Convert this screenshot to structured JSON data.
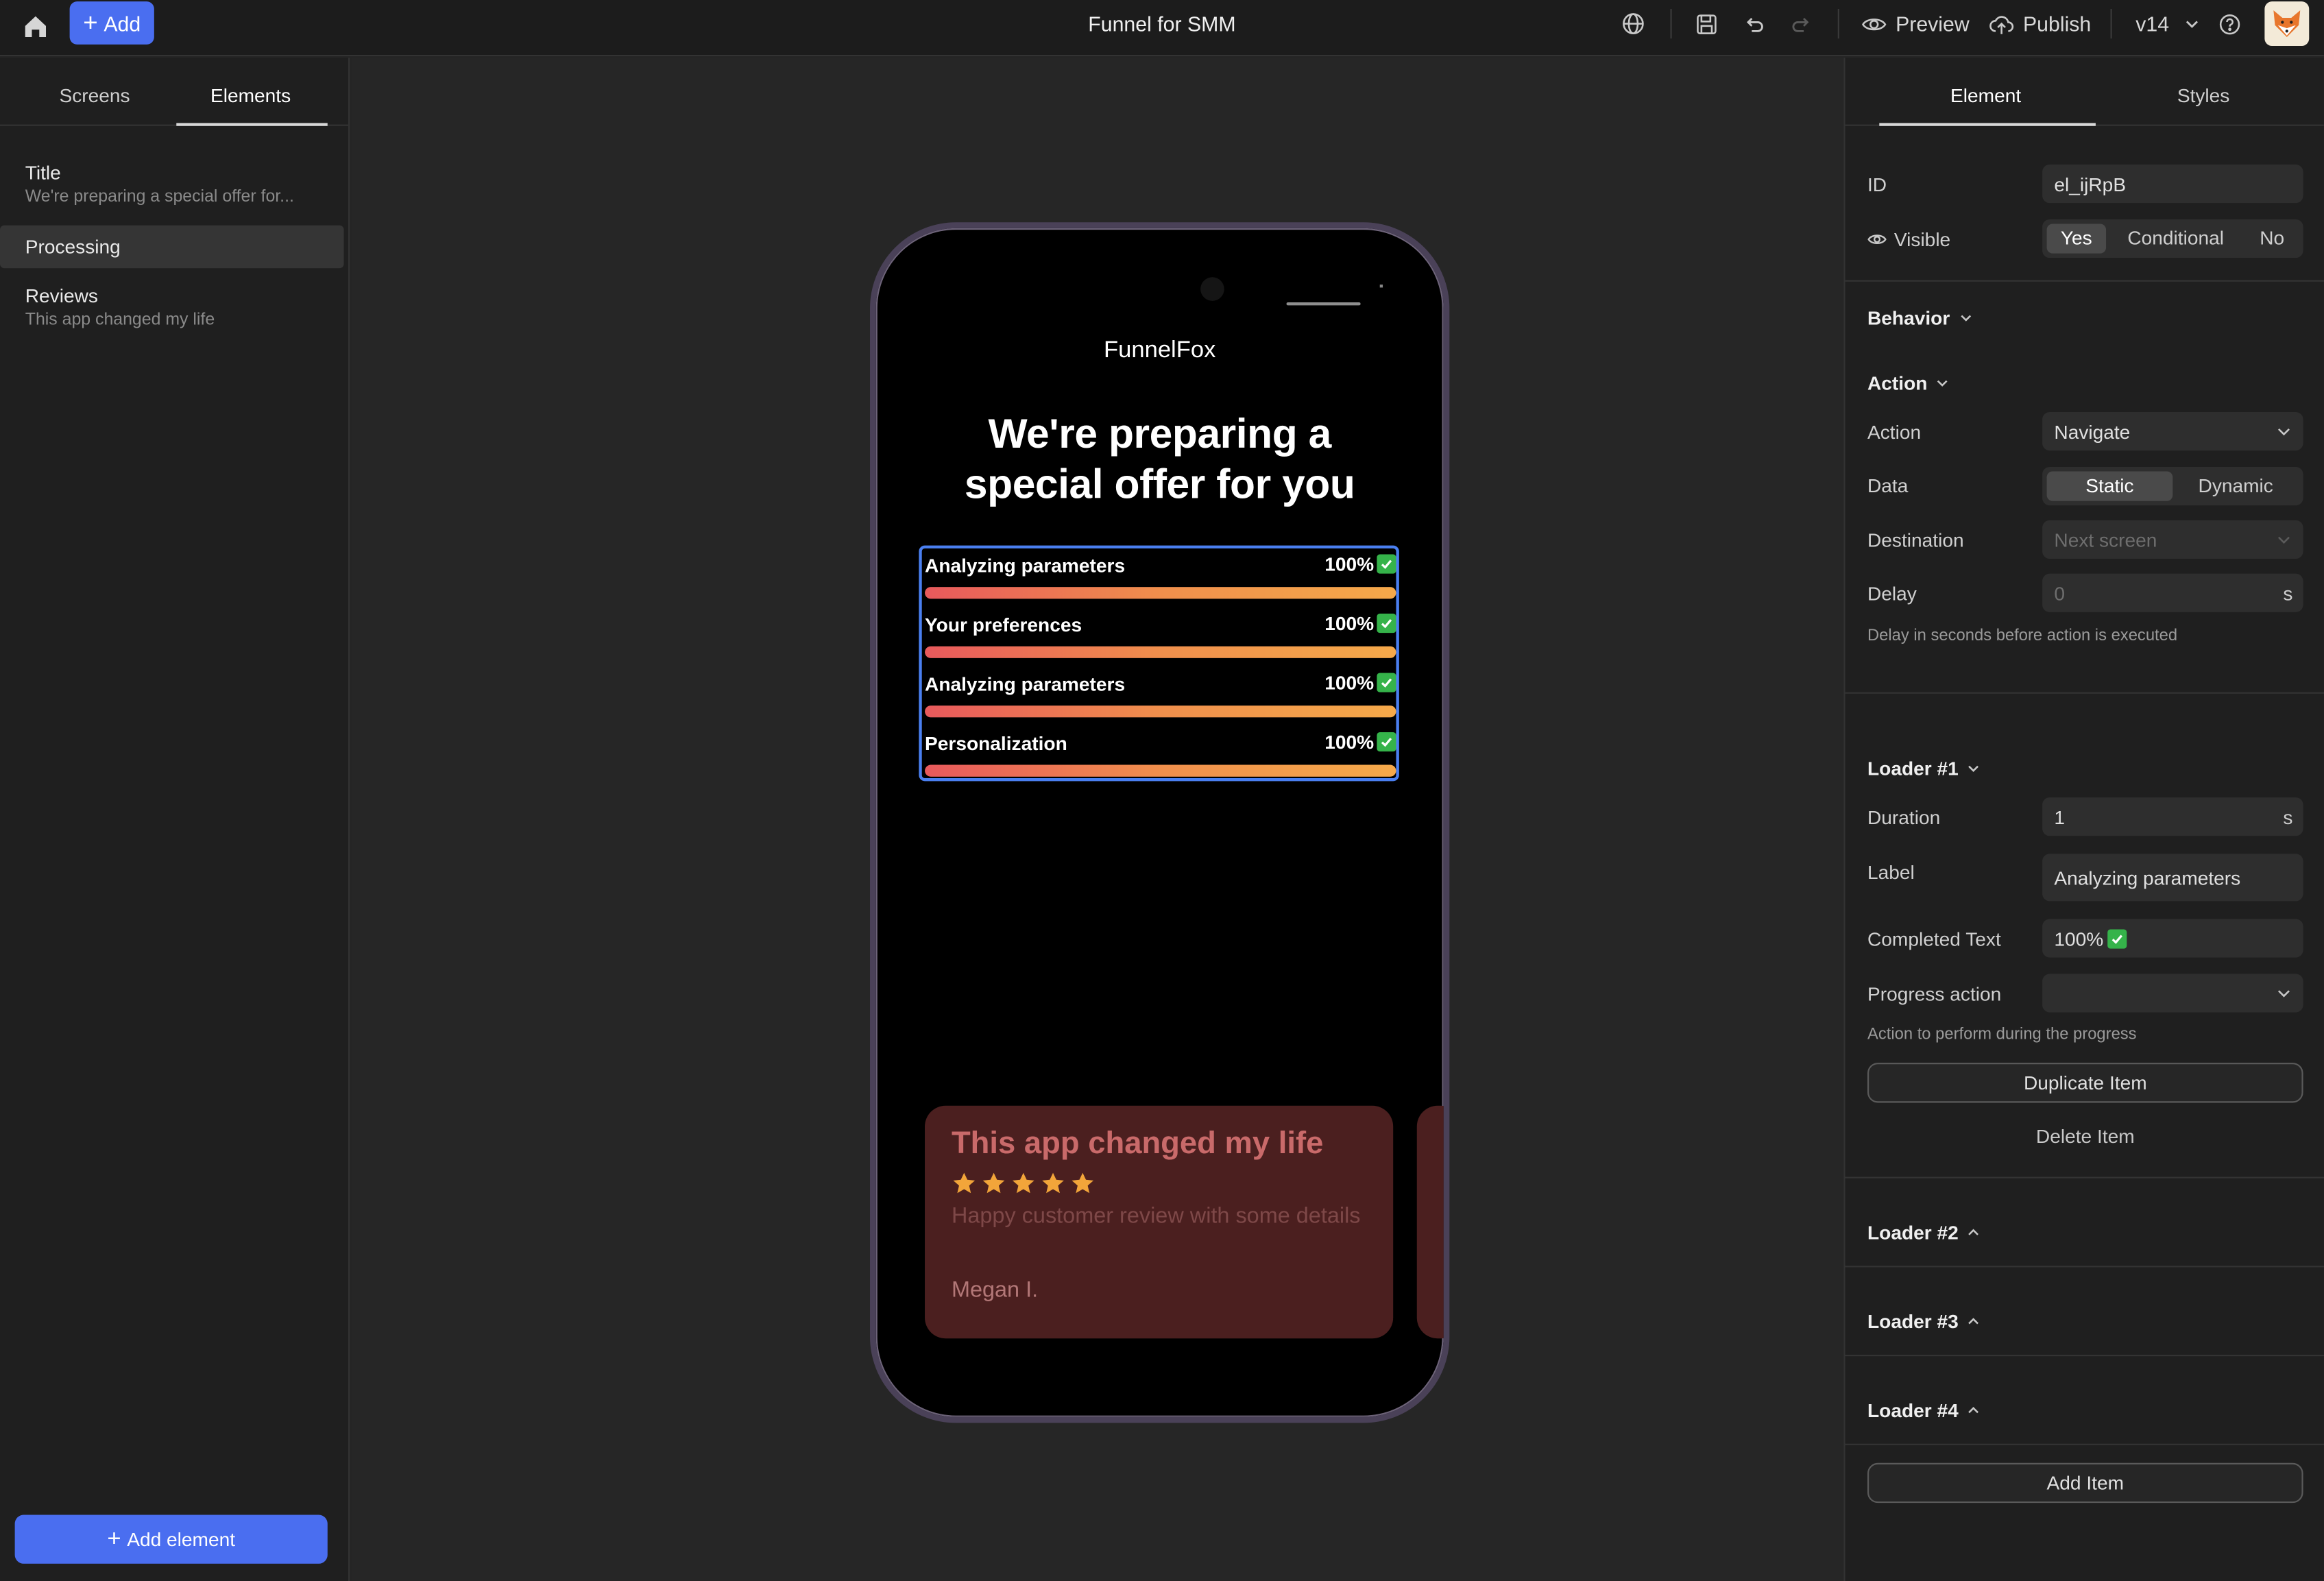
{
  "header": {
    "add_label": "Add",
    "title": "Funnel for SMM",
    "preview_label": "Preview",
    "publish_label": "Publish",
    "version": "v14"
  },
  "left_panel": {
    "tabs": [
      {
        "label": "Screens"
      },
      {
        "label": "Elements"
      }
    ],
    "active_tab": "Elements",
    "layers": [
      {
        "title": "Title",
        "subtitle": "We're preparing a special offer for..."
      },
      {
        "title": "Processing",
        "subtitle": ""
      },
      {
        "title": "Reviews",
        "subtitle": "This app changed my life"
      }
    ],
    "selected_layer": "Processing",
    "add_element_label": "Add element"
  },
  "phone": {
    "brand": "FunnelFox",
    "headline": "We're preparing a special offer for you",
    "loaders": [
      {
        "label": "Analyzing parameters",
        "completed": "100%",
        "progress": 1.0
      },
      {
        "label": "Your preferences",
        "completed": "100%",
        "progress": 1.0
      },
      {
        "label": "Analyzing parameters",
        "completed": "100%",
        "progress": 1.0
      },
      {
        "label": "Personalization",
        "completed": "100%",
        "progress": 1.0
      }
    ],
    "review": {
      "title": "This app changed my life",
      "rating": 5,
      "text": "Happy customer review with some details",
      "author": "Megan I."
    }
  },
  "right_panel": {
    "tabs": [
      {
        "label": "Element"
      },
      {
        "label": "Styles"
      }
    ],
    "active_tab": "Element",
    "id_label": "ID",
    "id_value": "el_ijRpB",
    "visible_label": "Visible",
    "visible_options": [
      "Yes",
      "Conditional",
      "No"
    ],
    "visible_selected": "Yes",
    "behavior_label": "Behavior",
    "action_section_label": "Action",
    "action_label": "Action",
    "action_value": "Navigate",
    "data_label": "Data",
    "data_options": [
      "Static",
      "Dynamic"
    ],
    "data_selected": "Static",
    "destination_label": "Destination",
    "destination_placeholder": "Next screen",
    "delay_label": "Delay",
    "delay_placeholder": "0",
    "delay_unit": "s",
    "delay_help": "Delay in seconds before action is executed",
    "loader1": {
      "header": "Loader #1",
      "duration_label": "Duration",
      "duration_value": "1",
      "duration_unit": "s",
      "label_label": "Label",
      "label_value": "Analyzing parameters",
      "completed_label": "Completed Text",
      "completed_value": "100%",
      "progress_action_label": "Progress action",
      "progress_action_value": "",
      "progress_action_help": "Action to perform during the progress",
      "duplicate_label": "Duplicate Item",
      "delete_label": "Delete Item"
    },
    "collapsed_loaders": [
      {
        "header": "Loader #2"
      },
      {
        "header": "Loader #3"
      },
      {
        "header": "Loader #4"
      }
    ],
    "add_item_label": "Add Item"
  },
  "colors": {
    "accent": "#4a6ef0",
    "selection": "#4a7ff0",
    "progress_start": "#e8595c",
    "progress_end": "#f5a94a",
    "check": "#35b34a",
    "star": "#f2a53a",
    "review_card": "#4b1f1f"
  },
  "icons": {
    "home": "home-icon",
    "plus": "plus-icon",
    "globe": "globe-icon",
    "save": "save-icon",
    "undo": "undo-icon",
    "redo": "redo-icon",
    "preview": "eye-icon",
    "publish": "cloud-upload-icon",
    "chevron": "chevron-down-icon",
    "help": "help-circle-icon",
    "visible": "eye-icon",
    "check": "check-box-icon",
    "star": "star-icon"
  }
}
